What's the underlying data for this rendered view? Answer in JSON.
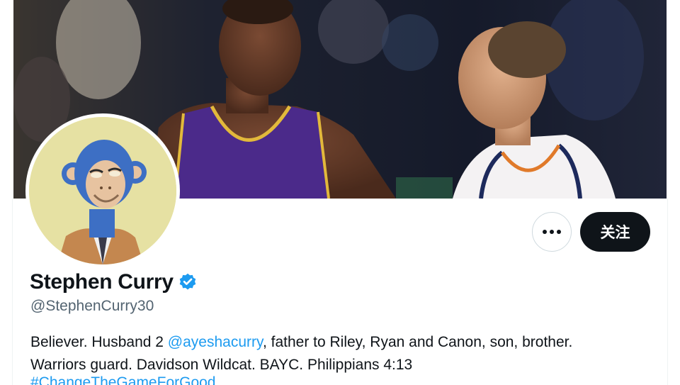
{
  "profile": {
    "name": "Stephen Curry",
    "handle": "@StephenCurry30",
    "verified": true,
    "bio_line1_pre": "Believer. Husband 2 ",
    "bio_mention": "@ayeshacurry",
    "bio_line1_post": ", father to Riley, Ryan and Canon, son, brother.",
    "bio_line2": "Warriors guard. Davidson Wildcat. BAYC. Philippians 4:13",
    "bio_hashtag": "#ChangeTheGameForGood"
  },
  "actions": {
    "more_label": "•••",
    "follow_label": "关注"
  },
  "colors": {
    "accent": "#1d9bf0",
    "follow_bg": "#0f1419",
    "text_primary": "#0f1419",
    "text_secondary": "#536471",
    "avatar_bg": "#e6e1a3"
  },
  "icons": {
    "verified": "verified-badge-icon",
    "more": "more-dots-icon"
  }
}
